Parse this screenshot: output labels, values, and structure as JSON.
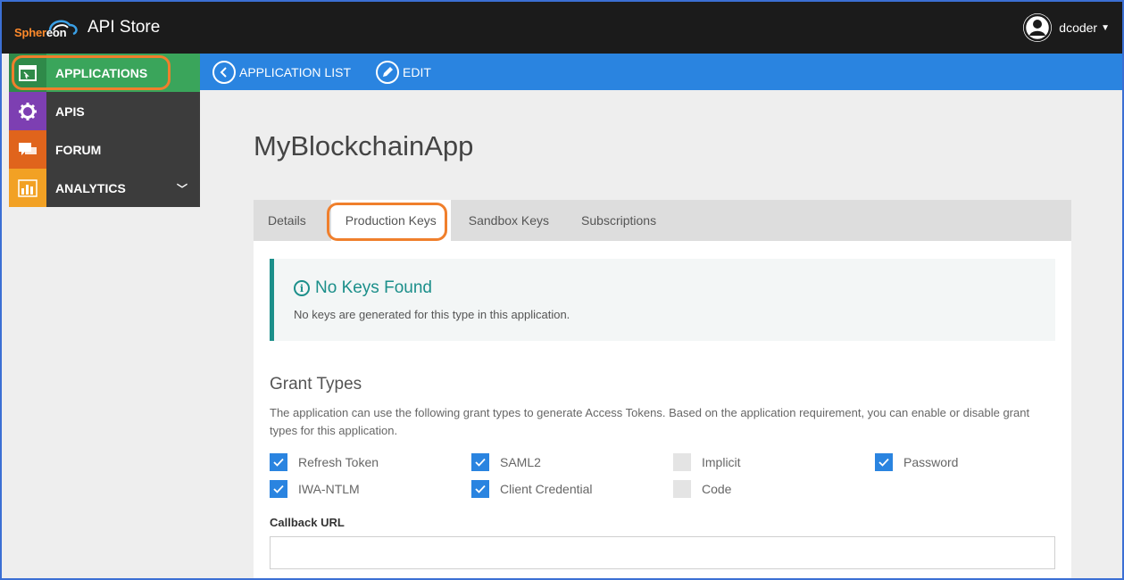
{
  "header": {
    "brand_logo": "Sphereon",
    "title": "API Store",
    "user_name": "dcoder"
  },
  "sidebar": {
    "items": [
      {
        "label": "APPLICATIONS",
        "icon": "application-window-icon",
        "color": "#3aa55b"
      },
      {
        "label": "APIS",
        "icon": "api-gear-icon",
        "color": "#7d3fb2"
      },
      {
        "label": "FORUM",
        "icon": "chat-bubble-icon",
        "color": "#e0641c"
      },
      {
        "label": "ANALYTICS",
        "icon": "bar-chart-icon",
        "color": "#f2a124"
      }
    ]
  },
  "actionbar": {
    "back_label": "APPLICATION LIST",
    "edit_label": "EDIT"
  },
  "app": {
    "name": "MyBlockchainApp"
  },
  "tabs": [
    "Details",
    "Production Keys",
    "Sandbox Keys",
    "Subscriptions"
  ],
  "notice": {
    "title": "No Keys Found",
    "text": "No keys are generated for this type in this application."
  },
  "grant_types": {
    "title": "Grant Types",
    "description": "The application can use the following grant types to generate Access Tokens. Based on the application requirement, you can enable or disable grant types for this application.",
    "options": [
      {
        "label": "Refresh Token",
        "checked": true
      },
      {
        "label": "SAML2",
        "checked": true
      },
      {
        "label": "Implicit",
        "checked": false
      },
      {
        "label": "Password",
        "checked": true
      },
      {
        "label": "IWA-NTLM",
        "checked": true
      },
      {
        "label": "Client Credential",
        "checked": true
      },
      {
        "label": "Code",
        "checked": false
      }
    ]
  },
  "callback": {
    "label": "Callback URL",
    "value": ""
  },
  "colors": {
    "accent_blue": "#2a84e0",
    "highlight_orange": "#f07f2c",
    "notice_teal": "#1b8f8a"
  }
}
